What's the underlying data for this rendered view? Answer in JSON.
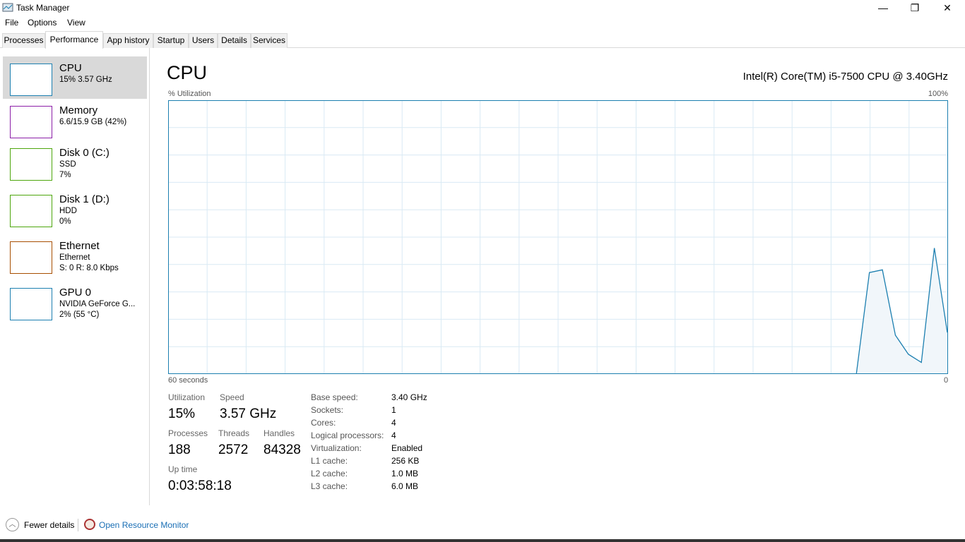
{
  "window": {
    "title": "Task Manager",
    "minimize": "—",
    "restore": "❐",
    "close": "✕"
  },
  "menu": [
    "File",
    "Options",
    "View"
  ],
  "tabs": [
    "Processes",
    "Performance",
    "App history",
    "Startup",
    "Users",
    "Details",
    "Services"
  ],
  "sidebar": [
    {
      "name": "CPU",
      "line1": "15% 3.57 GHz",
      "line2": "",
      "color": "#1c7fb0"
    },
    {
      "name": "Memory",
      "line1": "6.6/15.9 GB (42%)",
      "line2": "",
      "color": "#8b1ea7"
    },
    {
      "name": "Disk 0 (C:)",
      "line1": "SSD",
      "line2": "7%",
      "color": "#4da60c"
    },
    {
      "name": "Disk 1 (D:)",
      "line1": "HDD",
      "line2": "0%",
      "color": "#4da60c"
    },
    {
      "name": "Ethernet",
      "line1": "Ethernet",
      "line2": "S: 0 R: 8.0 Kbps",
      "color": "#a74f01"
    },
    {
      "name": "GPU 0",
      "line1": "NVIDIA GeForce G...",
      "line2": "2% (55 °C)",
      "color": "#1c7fb0"
    }
  ],
  "main": {
    "title": "CPU",
    "model": "Intel(R) Core(TM) i5-7500 CPU @ 3.40GHz",
    "y_label": "% Utilization",
    "y_max_label": "100%",
    "x_left_label": "60 seconds",
    "x_right_label": "0",
    "stats": {
      "utilization_label": "Utilization",
      "utilization": "15%",
      "speed_label": "Speed",
      "speed": "3.57 GHz",
      "processes_label": "Processes",
      "processes": "188",
      "threads_label": "Threads",
      "threads": "2572",
      "handles_label": "Handles",
      "handles": "84328",
      "uptime_label": "Up time",
      "uptime": "0:03:58:18"
    },
    "specs": [
      [
        "Base speed:",
        "3.40 GHz"
      ],
      [
        "Sockets:",
        "1"
      ],
      [
        "Cores:",
        "4"
      ],
      [
        "Logical processors:",
        "4"
      ],
      [
        "Virtualization:",
        "Enabled"
      ],
      [
        "L1 cache:",
        "256 KB"
      ],
      [
        "L2 cache:",
        "1.0 MB"
      ],
      [
        "L3 cache:",
        "6.0 MB"
      ]
    ]
  },
  "chart_data": {
    "type": "area",
    "xlabel": "60 seconds",
    "ylabel": "% Utilization",
    "ylim": [
      0,
      100
    ],
    "xlim": [
      60,
      0
    ],
    "grid": true,
    "color": "#1c7fb0",
    "x": [
      7,
      6,
      5,
      4,
      3,
      2,
      1,
      0
    ],
    "values": [
      0,
      37,
      38,
      14,
      7,
      4,
      46,
      15
    ]
  },
  "footer": {
    "fewer": "Fewer details",
    "resmon": "Open Resource Monitor"
  }
}
